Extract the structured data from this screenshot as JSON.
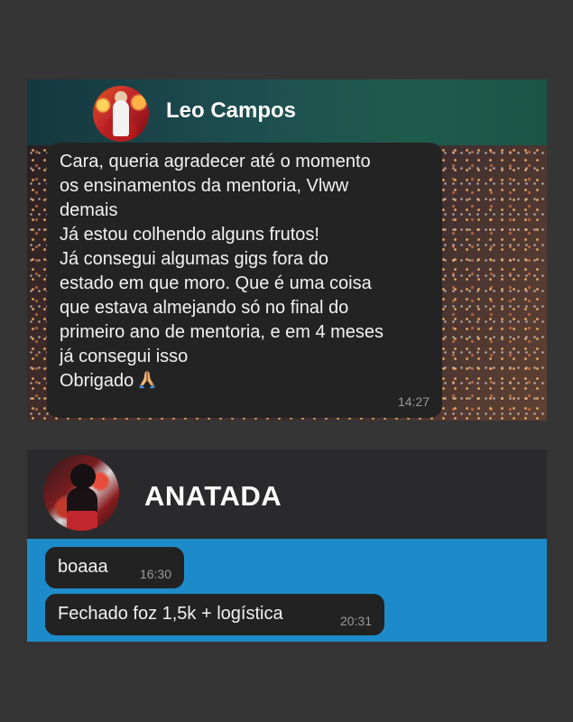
{
  "chat1": {
    "contact_name": "Leo Campos",
    "avatar_icon": "user-avatar-icon",
    "message_lines": [
      "Cara, queria agradecer até o momento",
      "os ensinamentos da mentoria, Vlww",
      "demais",
      "Já estou colhendo alguns frutos!",
      "Já consegui algumas gigs fora do",
      "estado em que moro. Que é uma coisa",
      "que estava almejando só no final do",
      "primeiro ano de mentoria, e em 4 meses",
      "já consegui isso",
      "Obrigado"
    ],
    "emoji": "praying-hands-icon",
    "time": "14:27"
  },
  "chat2": {
    "contact_name": "ANATADA",
    "avatar_icon": "user-avatar-icon",
    "messages": [
      {
        "text": "boaaa",
        "time": "16:30"
      },
      {
        "text": "Fechado foz 1,5k + logística",
        "time": "20:31"
      }
    ]
  },
  "colors": {
    "page_background": "#353535",
    "bubble": "#232323",
    "chat2_panel": "#1d8bc9",
    "chat1_header": "#1d4d50"
  }
}
